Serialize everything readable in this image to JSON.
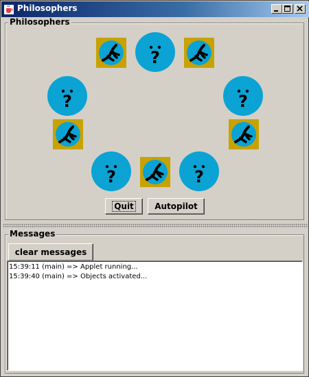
{
  "window": {
    "title": "Philosophers",
    "minimize_icon": "minimize-icon",
    "maximize_icon": "maximize-icon",
    "close_icon": "close-icon"
  },
  "philosophers_panel": {
    "title": "Philosophers",
    "philosopher_icon": "thinking-face-icon",
    "fork_icon": "fork-icon",
    "quit_label": "Quit",
    "autopilot_label": "Autopilot"
  },
  "messages_panel": {
    "title": "Messages",
    "clear_label": "clear messages",
    "lines": [
      "15:39:11 (main) => Applet running...",
      "15:39:40 (main) => Objects activated..."
    ]
  },
  "colors": {
    "title_bar_start": "#0a246a",
    "title_bar_end": "#a6caf0",
    "philosopher": "#0aa3d4",
    "fork_frame": "#c8a200",
    "background": "#d4d0c8"
  }
}
